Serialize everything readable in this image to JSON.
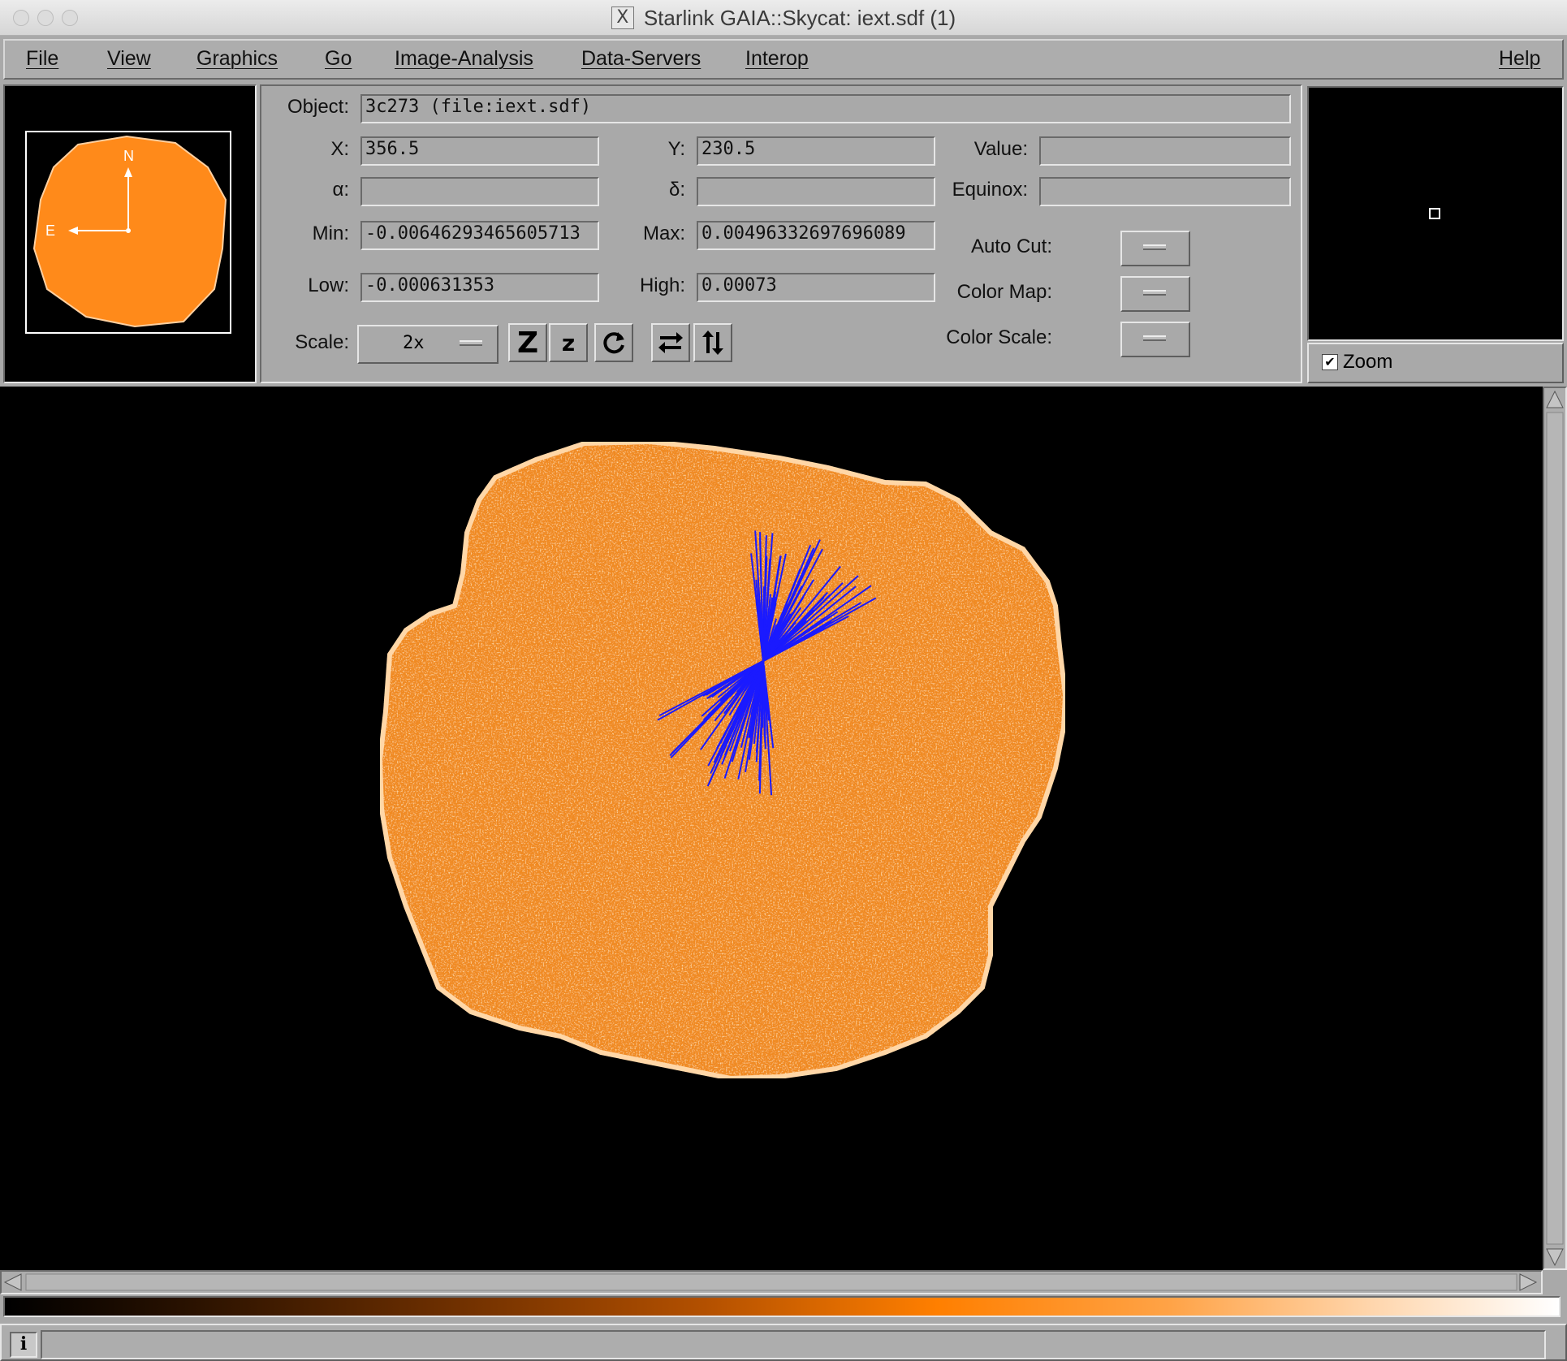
{
  "window": {
    "title": "Starlink GAIA::Skycat: iext.sdf (1)",
    "x_icon": "X"
  },
  "menubar": {
    "file": "File",
    "view": "View",
    "graphics": "Graphics",
    "go": "Go",
    "image_analysis": "Image-Analysis",
    "data_servers": "Data-Servers",
    "interop": "Interop",
    "help": "Help"
  },
  "panner": {
    "north": "N",
    "east": "E"
  },
  "info": {
    "object_label": "Object:",
    "object_value": "3c273 (file:iext.sdf)",
    "x_label": "X:",
    "x_value": "356.5",
    "y_label": "Y:",
    "y_value": "230.5",
    "value_label": "Value:",
    "value_value": "",
    "alpha_label": "α:",
    "alpha_value": "",
    "delta_label": "δ:",
    "delta_value": "",
    "equinox_label": "Equinox:",
    "equinox_value": "",
    "min_label": "Min:",
    "min_value": "-0.00646293465605713",
    "max_label": "Max:",
    "max_value": "0.00496332697696089",
    "low_label": "Low:",
    "low_value": "-0.000631353",
    "high_label": "High:",
    "high_value": "0.00073",
    "autocut_label": "Auto Cut:",
    "colormap_label": "Color Map:",
    "colorscale_label": "Color Scale:",
    "scale_label": "Scale:",
    "scale_value": "2x"
  },
  "toolbar": {
    "zoom_in": "Z",
    "zoom_out": "z"
  },
  "zoom": {
    "checkbox_label": "Zoom",
    "checked": true
  },
  "status": {
    "info_icon": "i"
  },
  "colors": {
    "image_orange": "#ff7f00",
    "vector_blue": "#1010ff",
    "panel_gray": "#a9a9a9"
  },
  "icons": [
    "rotate-icon",
    "flip-x-icon",
    "flip-y-icon",
    "info-icon",
    "check-icon",
    "scroll-arrow-icons"
  ]
}
